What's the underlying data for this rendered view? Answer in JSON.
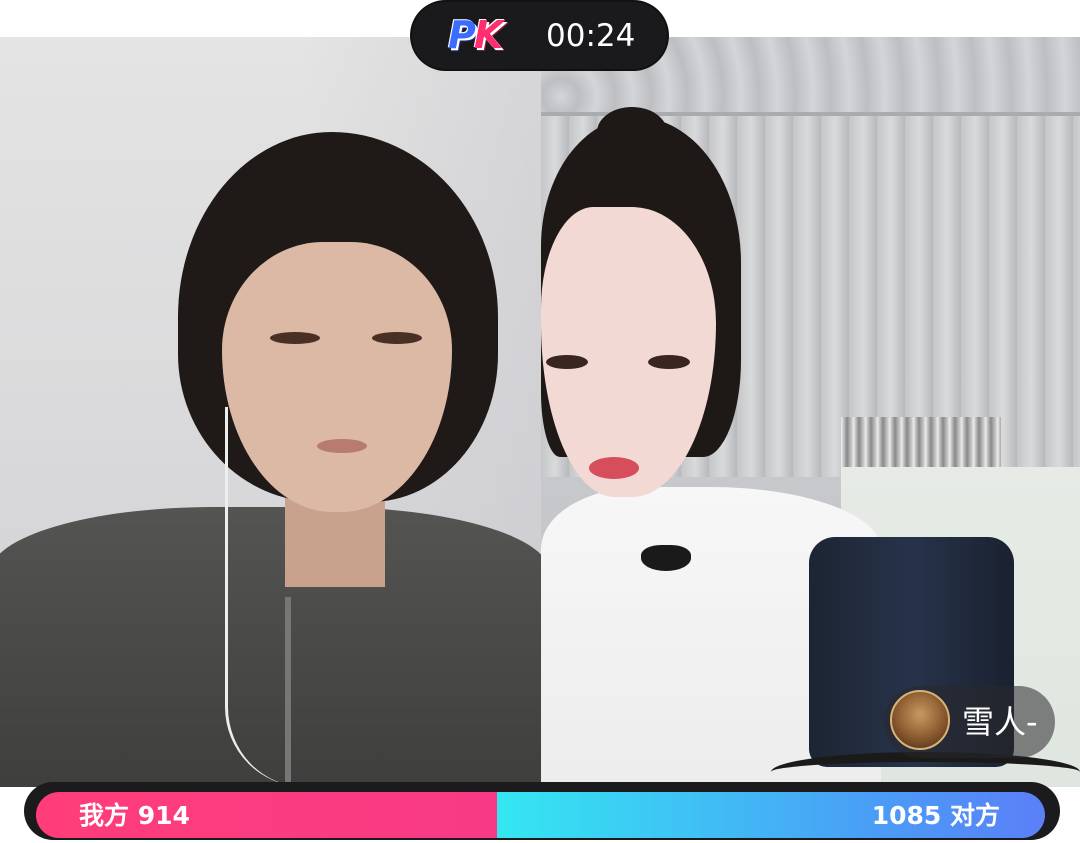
{
  "header": {
    "logo_text_p": "P",
    "logo_text_k": "K",
    "timer": "00:24"
  },
  "guest": {
    "name": "雪人-",
    "avatar_icon": "user-avatar-icon"
  },
  "score": {
    "left_label": "我方 914",
    "right_label": "1085 对方",
    "left_value": 914,
    "right_value": 1085,
    "left_color": "#ff3d7a",
    "right_color": "#34e7f2"
  },
  "panes": {
    "left": "host-video",
    "right": "opponent-video"
  }
}
